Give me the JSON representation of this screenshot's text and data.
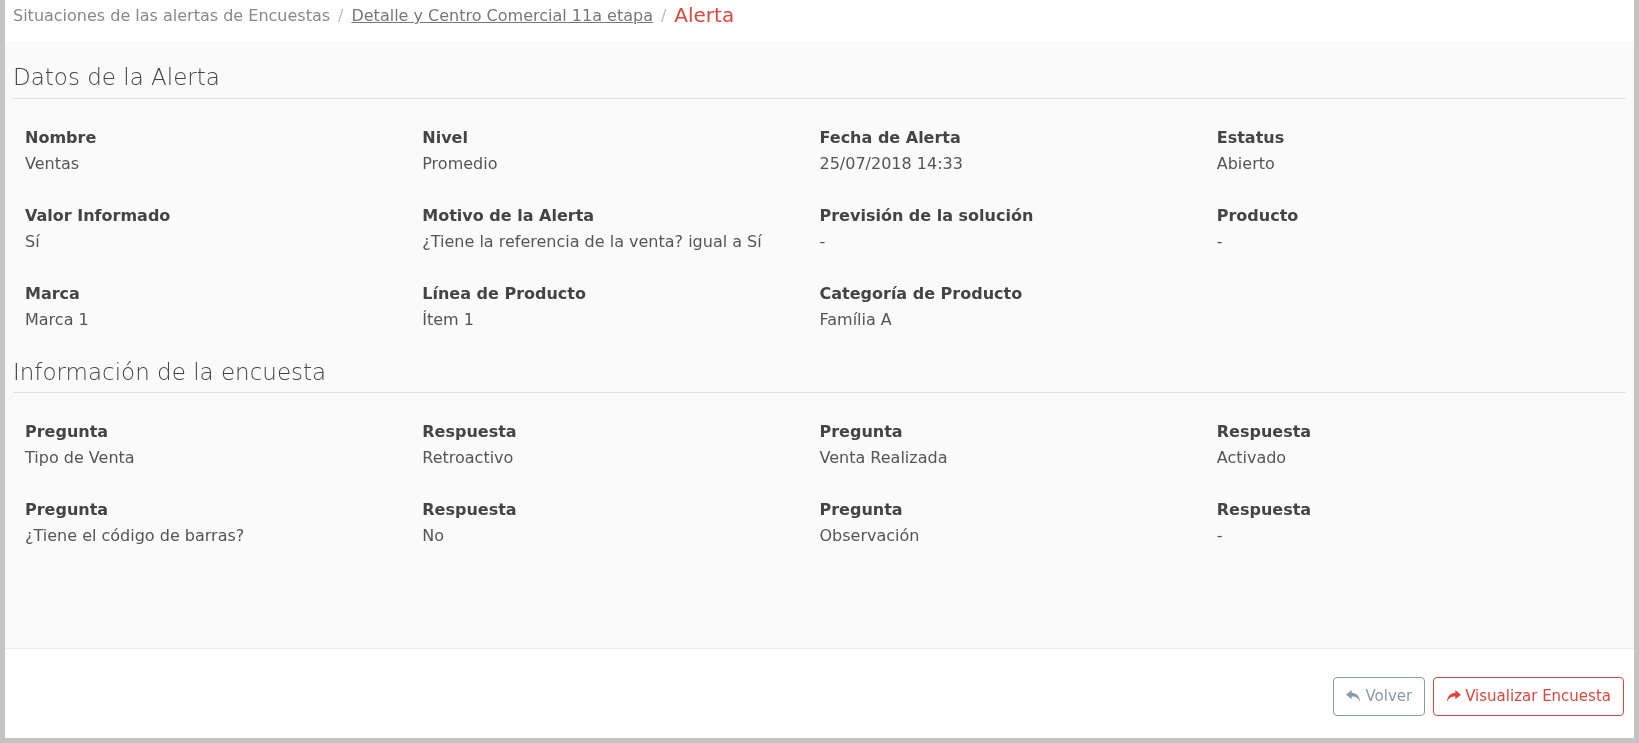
{
  "breadcrumb": [
    {
      "label": "Situaciones de las alertas de Encuestas",
      "kind": "plain"
    },
    {
      "separator": "/",
      "label": "Detalle y Centro Comercial 11a etapa",
      "kind": "link"
    },
    {
      "separator": "/",
      "label": "Alerta",
      "kind": "current"
    }
  ],
  "sections": [
    {
      "title": "Datos de la Alerta",
      "fields": [
        {
          "label": "Nombre",
          "value": "Ventas"
        },
        {
          "label": "Nivel",
          "value": "Promedio"
        },
        {
          "label": "Fecha de Alerta",
          "value": "25/07/2018 14:33"
        },
        {
          "label": "Estatus",
          "value": "Abierto"
        },
        {
          "label": "Valor Informado",
          "value": "Sí"
        },
        {
          "label": "Motivo de la Alerta",
          "value": "¿Tiene la referencia de la venta? igual a Sí"
        },
        {
          "label": "Previsión de la solución",
          "value": "-"
        },
        {
          "label": "Producto",
          "value": "-"
        },
        {
          "label": "Marca",
          "value": "Marca 1"
        },
        {
          "label": "Línea de Producto",
          "value": "Ítem 1"
        },
        {
          "label": "Categoría de Producto",
          "value": "Família A"
        }
      ]
    },
    {
      "title": "Información de la encuesta",
      "fields": [
        {
          "label": "Pregunta",
          "value": "Tipo de Venta"
        },
        {
          "label": "Respuesta",
          "value": "Retroactivo"
        },
        {
          "label": "Pregunta",
          "value": "Venta Realizada"
        },
        {
          "label": "Respuesta",
          "value": "Activado"
        },
        {
          "label": "Pregunta",
          "value": "¿Tiene el código de barras?"
        },
        {
          "label": "Respuesta",
          "value": "No"
        },
        {
          "label": "Pregunta",
          "value": "Observación"
        },
        {
          "label": "Respuesta",
          "value": "-"
        }
      ]
    }
  ],
  "buttons": [
    {
      "label": "Volver",
      "kind": "back"
    },
    {
      "label": "Visualizar Encuesta",
      "kind": "forward"
    }
  ]
}
